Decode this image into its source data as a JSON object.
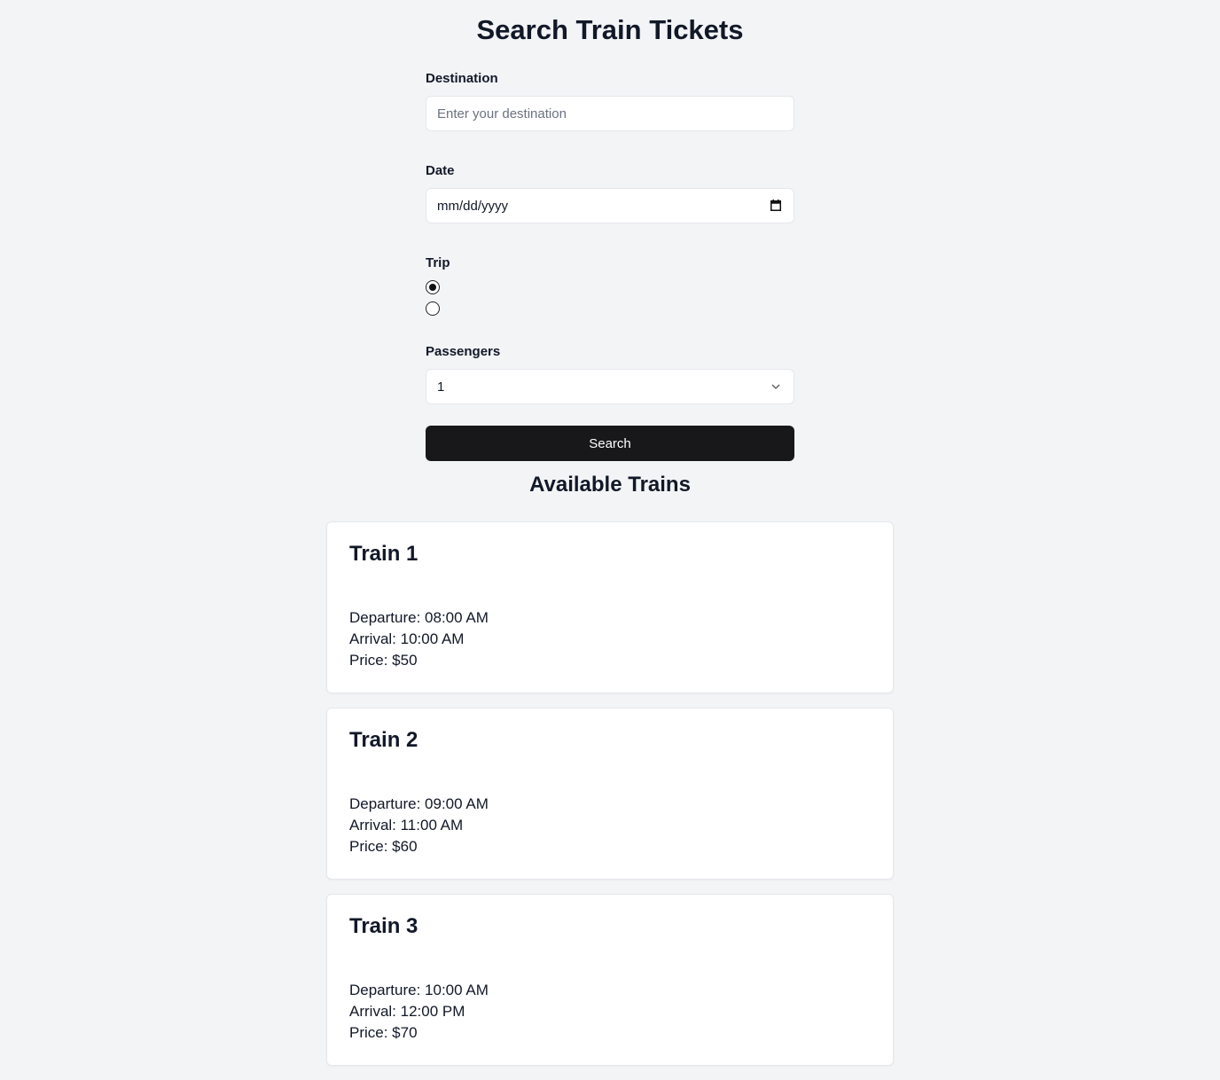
{
  "page_title": "Search Train Tickets",
  "form": {
    "destination_label": "Destination",
    "destination_placeholder": "Enter your destination",
    "date_label": "Date",
    "date_placeholder": "mm/dd/yyyy",
    "trip_label": "Trip",
    "trip_options": [
      {
        "checked": true
      },
      {
        "checked": false
      }
    ],
    "passengers_label": "Passengers",
    "passengers_value": "1",
    "search_label": "Search"
  },
  "results": {
    "title": "Available Trains",
    "trains": [
      {
        "name": "Train 1",
        "departure": "Departure: 08:00 AM",
        "arrival": "Arrival: 10:00 AM",
        "price": "Price: $50"
      },
      {
        "name": "Train 2",
        "departure": "Departure: 09:00 AM",
        "arrival": "Arrival: 11:00 AM",
        "price": "Price: $60"
      },
      {
        "name": "Train 3",
        "departure": "Departure: 10:00 AM",
        "arrival": "Arrival: 12:00 PM",
        "price": "Price: $70"
      }
    ]
  },
  "colors": {
    "background": "#f3f4f6",
    "button": "#18181b",
    "card": "#ffffff"
  },
  "icons": {
    "date": "calendar-icon",
    "select": "chevron-down-icon"
  }
}
